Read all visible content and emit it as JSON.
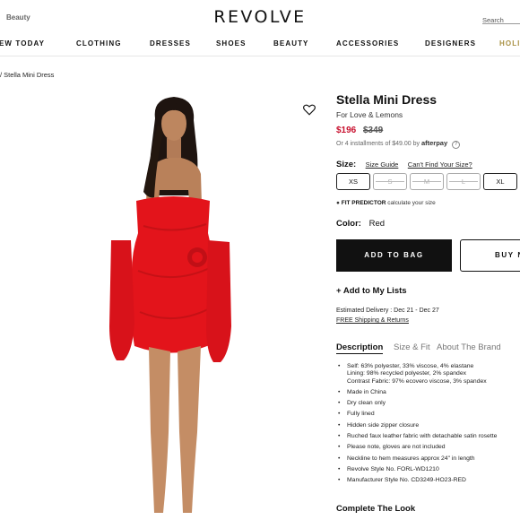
{
  "header": {
    "beauty_link": "Beauty",
    "logo": "REVOLVE",
    "search_placeholder": "Search"
  },
  "nav": {
    "items": [
      "EW TODAY",
      "CLOTHING",
      "DRESSES",
      "SHOES",
      "BEAUTY",
      "ACCESSORIES",
      "DESIGNERS",
      "HOLI"
    ]
  },
  "breadcrumb": "/ Stella Mini Dress",
  "product": {
    "title": "Stella Mini Dress",
    "brand": "For Love & Lemons",
    "price": "$196",
    "original_price": "$349",
    "installments": "Or 4 installments of $49.00 by",
    "afterpay": "afterpay",
    "size_label": "Size:",
    "size_guide": "Size Guide",
    "cant_find_size": "Can't Find Your Size?",
    "sizes": [
      "XS",
      "S",
      "M",
      "L",
      "XL"
    ],
    "fit_predictor": "FIT PREDICTOR",
    "fit_predictor_sub": "calculate your size",
    "color_label": "Color:",
    "color_value": "Red",
    "add_to_bag": "ADD TO BAG",
    "buy_now": "BUY N",
    "add_to_lists": "+ Add to My Lists",
    "estimated_delivery": "Estimated Delivery : Dec 21 - Dec 27",
    "shipping": "FREE Shipping & Returns",
    "tabs": [
      "Description",
      "Size & Fit",
      "About The Brand"
    ],
    "description": [
      "Self: 63% polyester, 33% viscose, 4% elastane",
      "Lining: 98% recycled polyester, 2% spandex",
      "Contrast Fabric: 97% ecovero viscose, 3% spandex",
      "Made in China",
      "Dry clean only",
      "Fully lined",
      "Hidden side zipper closure",
      "Ruched faux leather fabric with detachable satin rosette",
      "Please note, gloves are not included",
      "Neckline to hem measures approx 24\" in length",
      "Revolve Style No. FORL-WD1210",
      "Manufacturer Style No. CD3249-HO23-RED"
    ],
    "complete_the_look": "Complete The Look"
  },
  "colors": {
    "sale_price": "#c8102e",
    "accent_gold": "#a99143",
    "dress_red": "#e3141b"
  }
}
